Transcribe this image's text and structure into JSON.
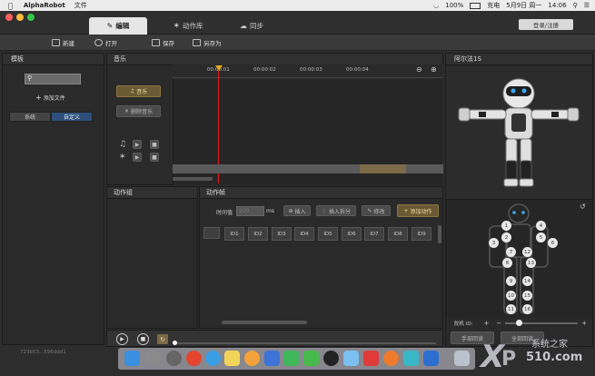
{
  "menubar": {
    "app_name": "AlphaRobot",
    "file_menu": "文件",
    "battery": "100%",
    "battery_label": "充电",
    "date": "5月9日 周一",
    "time": "14:06"
  },
  "tabs": [
    {
      "label": "编辑",
      "icon": "edit-icon"
    },
    {
      "label": "动作库",
      "icon": "figure-icon"
    },
    {
      "label": "同步",
      "icon": "cloud-icon"
    }
  ],
  "login_label": "登录/注册",
  "toolbar": {
    "new_label": "新建",
    "open_label": "打开",
    "save_label": "保存",
    "save_as_label": "另存为"
  },
  "template_panel": {
    "title": "模板",
    "add_file_label": "添加文件",
    "tab_system": "系统",
    "tab_custom": "自定义"
  },
  "music_panel": {
    "title": "音乐",
    "music_button": "音乐",
    "delete_music_button": "删除音乐",
    "timeline_ticks": [
      "00:00:01",
      "00:00:02",
      "00:00:03",
      "00:00:04"
    ]
  },
  "action_group_panel": {
    "title": "动作组"
  },
  "action_frame_panel": {
    "title": "动作帧",
    "time_label": "时间值",
    "time_placeholder": "200",
    "time_unit": "ms",
    "insert_label": "插入",
    "insert_split_label": "插入拆分",
    "modify_label": "修改",
    "add_action_label": "添加动作",
    "ids": [
      "ID1",
      "ID2",
      "ID3",
      "ID4",
      "ID5",
      "ID6",
      "ID7",
      "ID8",
      "ID9"
    ]
  },
  "robot_panel": {
    "title": "阿尔法1S",
    "joints": [
      "1",
      "2",
      "3",
      "4",
      "5",
      "6",
      "7",
      "8",
      "9",
      "10",
      "11",
      "12",
      "13",
      "14",
      "15",
      "16"
    ],
    "servo_label": "舵机 ID:",
    "hand_label": "手部回读",
    "all_label": "全部回读"
  },
  "status": {
    "hash_text": "723b53...596ddd1"
  },
  "watermark": {
    "brand": "系统之家",
    "url": "510.com"
  },
  "colors": {
    "accent_yellow": "#c79a3b",
    "playhead_red": "#e02020",
    "robot_eye_blue": "#3fa9f5"
  }
}
